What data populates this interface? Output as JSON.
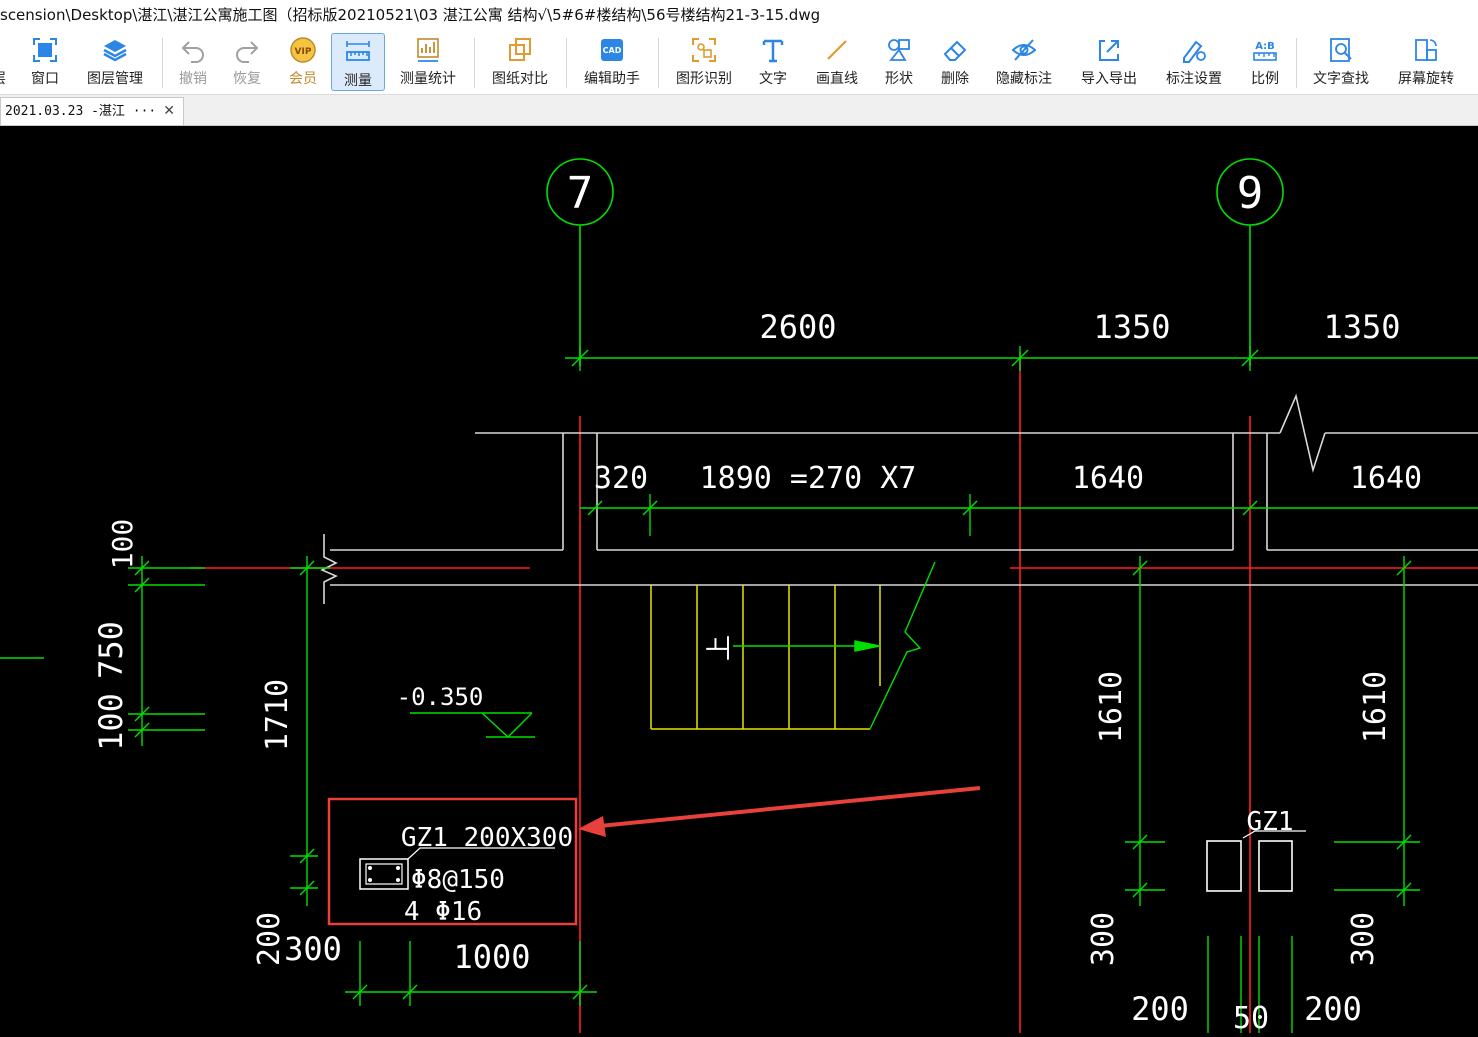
{
  "window": {
    "title": "scension\\Desktop\\湛江\\湛江公寓施工图（招标版20210521\\03 湛江公寓 结构√\\5#6#楼结构\\56号楼结构21-3-15.dwg"
  },
  "toolbar": {
    "items": [
      {
        "label": "窗口",
        "icon": "window-icon",
        "state": "normal"
      },
      {
        "label": "图层管理",
        "icon": "layers-icon",
        "state": "normal"
      },
      {
        "label": "撤销",
        "icon": "undo-icon",
        "state": "disabled"
      },
      {
        "label": "恢复",
        "icon": "redo-icon",
        "state": "disabled"
      },
      {
        "label": "会员",
        "icon": "vip-icon",
        "state": "vip"
      },
      {
        "label": "测量",
        "icon": "measure-icon",
        "state": "active"
      },
      {
        "label": "测量统计",
        "icon": "measure-stats-icon",
        "state": "normal"
      },
      {
        "label": "图纸对比",
        "icon": "compare-icon",
        "state": "normal"
      },
      {
        "label": "编辑助手",
        "icon": "cad-edit-icon",
        "state": "normal"
      },
      {
        "label": "图形识别",
        "icon": "shape-recognize-icon",
        "state": "normal"
      },
      {
        "label": "文字",
        "icon": "text-icon",
        "state": "normal"
      },
      {
        "label": "画直线",
        "icon": "line-icon",
        "state": "normal"
      },
      {
        "label": "形状",
        "icon": "shapes-icon",
        "state": "normal"
      },
      {
        "label": "删除",
        "icon": "eraser-icon",
        "state": "normal"
      },
      {
        "label": "隐藏标注",
        "icon": "hide-eye-icon",
        "state": "normal"
      },
      {
        "label": "导入导出",
        "icon": "import-export-icon",
        "state": "normal"
      },
      {
        "label": "标注设置",
        "icon": "annotation-settings-icon",
        "state": "normal"
      },
      {
        "label": "比例",
        "icon": "scale-icon",
        "state": "normal"
      },
      {
        "label": "文字查找",
        "icon": "text-search-icon",
        "state": "normal"
      },
      {
        "label": "屏幕旋转",
        "icon": "rotate-screen-icon",
        "state": "normal"
      }
    ]
  },
  "tabs": [
    {
      "label": "2021.03.23 -湛江 ···",
      "close": "✕"
    }
  ],
  "drawing": {
    "axes": [
      "7",
      "9"
    ],
    "dims_top": [
      "2600",
      "1350",
      "1350"
    ],
    "dims_second": [
      "320",
      "1890 =270 X7",
      "1640",
      "1640"
    ],
    "dims_left": [
      "100",
      "750",
      "100",
      "1710"
    ],
    "dims_right_vertical": [
      "1610",
      "1610"
    ],
    "dims_bottom": [
      "200",
      "300",
      "1000",
      "300",
      "200",
      "50",
      "200",
      "300"
    ],
    "elevation": "-0.350",
    "stair_label": "上",
    "column_callout": {
      "id": "GZ1 200X300",
      "stirrup": "Φ8@150",
      "longitudinal": "4 Φ16"
    },
    "column_tag": "GZ1",
    "colors": {
      "grid": "#ff2020",
      "dimension": "#00e000",
      "wall": "#d8d8d8",
      "stair": "#e6e600",
      "text": "#ffffff",
      "highlight": "#e8413c",
      "axis_bubble": "#00e000"
    }
  }
}
